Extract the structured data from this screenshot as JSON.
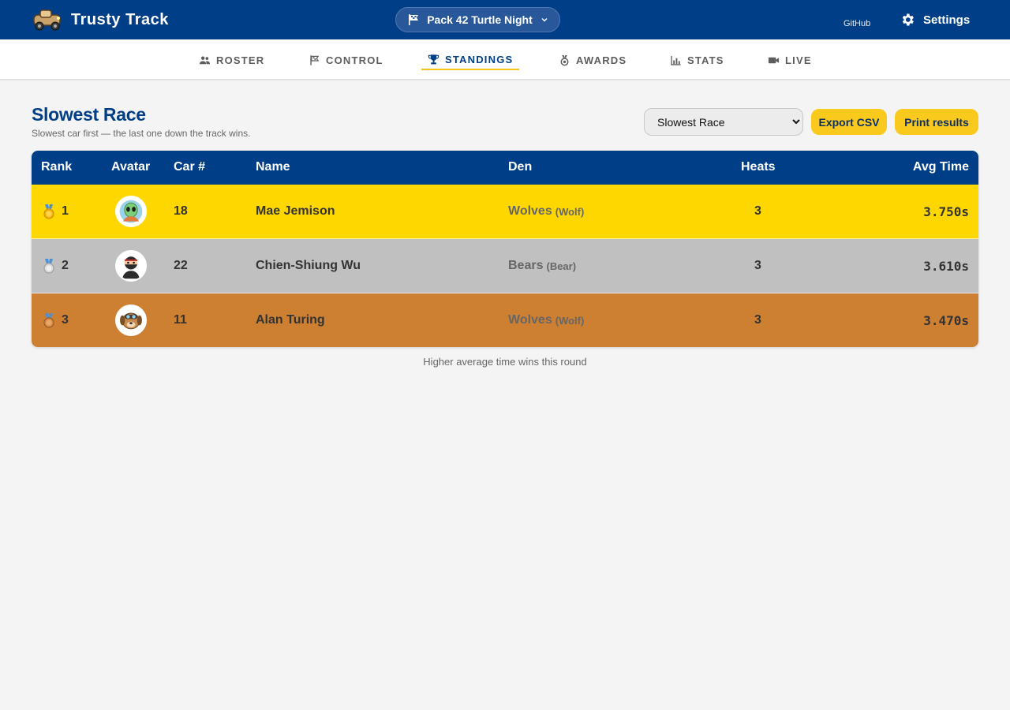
{
  "app": {
    "name": "Trusty Track"
  },
  "header": {
    "event_name": "Pack 42 Turtle Night",
    "github_label": "GitHub",
    "settings_label": "Settings"
  },
  "tabs": [
    {
      "label": "ROSTER",
      "icon": "people-icon",
      "active": false
    },
    {
      "label": "CONTROL",
      "icon": "flag-icon",
      "active": false
    },
    {
      "label": "STANDINGS",
      "icon": "trophy-icon",
      "active": true
    },
    {
      "label": "AWARDS",
      "icon": "medal-icon",
      "active": false
    },
    {
      "label": "STATS",
      "icon": "bar-chart-icon",
      "active": false
    },
    {
      "label": "LIVE",
      "icon": "video-camera-icon",
      "active": false
    }
  ],
  "standings": {
    "title": "Slowest Race",
    "subtitle": "Slowest car first — the last one down the track wins.",
    "select_value": "Slowest Race",
    "export_label": "Export CSV",
    "print_label": "Print results",
    "columns": {
      "rank": "Rank",
      "avatar": "Avatar",
      "car": "Car #",
      "name": "Name",
      "den": "Den",
      "heats": "Heats",
      "avg_time": "Avg Time"
    },
    "rows": [
      {
        "rank": "1",
        "medal": "gold-medal-icon",
        "avatar": "alien-avatar-icon",
        "car": "18",
        "name": "Mae Jemison",
        "den": "Wolves",
        "den_sub": "(Wolf)",
        "heats": "3",
        "avg_time": "3.750s",
        "row_color": "#ffd700"
      },
      {
        "rank": "2",
        "medal": "silver-medal-icon",
        "avatar": "ninja-avatar-icon",
        "car": "22",
        "name": "Chien-Shiung Wu",
        "den": "Bears",
        "den_sub": "(Bear)",
        "heats": "3",
        "avg_time": "3.610s",
        "row_color": "#c0c0c0"
      },
      {
        "rank": "3",
        "medal": "bronze-medal-icon",
        "avatar": "dog-aviator-avatar-icon",
        "car": "11",
        "name": "Alan Turing",
        "den": "Wolves",
        "den_sub": "(Wolf)",
        "heats": "3",
        "avg_time": "3.470s",
        "row_color": "#cd7f32"
      }
    ],
    "footnote": "Higher average time wins this round"
  },
  "colors": {
    "brand_blue": "#003f87",
    "accent_yellow": "#f9c91d",
    "gold": "#ffd700",
    "silver": "#c0c0c0",
    "bronze": "#cd7f32"
  }
}
